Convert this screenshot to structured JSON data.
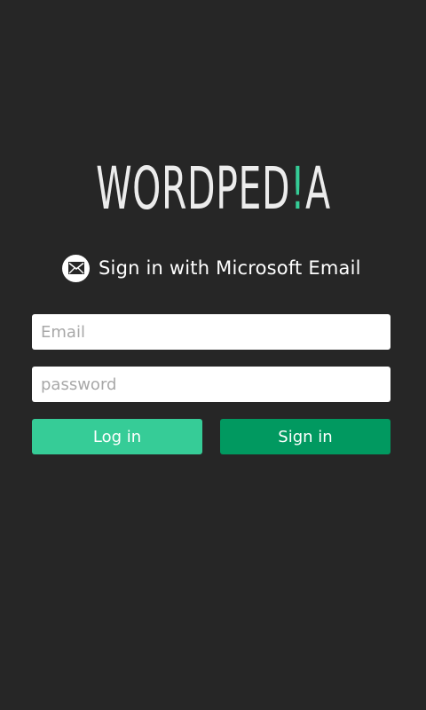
{
  "logo": {
    "text_before": "WORDPED",
    "accent": "!",
    "text_after": "A"
  },
  "microsoft_signin": {
    "icon": "mail-icon",
    "label": "Sign in with Microsoft Email"
  },
  "form": {
    "email_placeholder": "Email",
    "password_placeholder": "password",
    "login_label": "Log in",
    "signin_label": "Sign in"
  },
  "colors": {
    "background": "#262626",
    "accent": "#35cc96",
    "login_button": "#36cc97",
    "signin_button": "#019960"
  }
}
